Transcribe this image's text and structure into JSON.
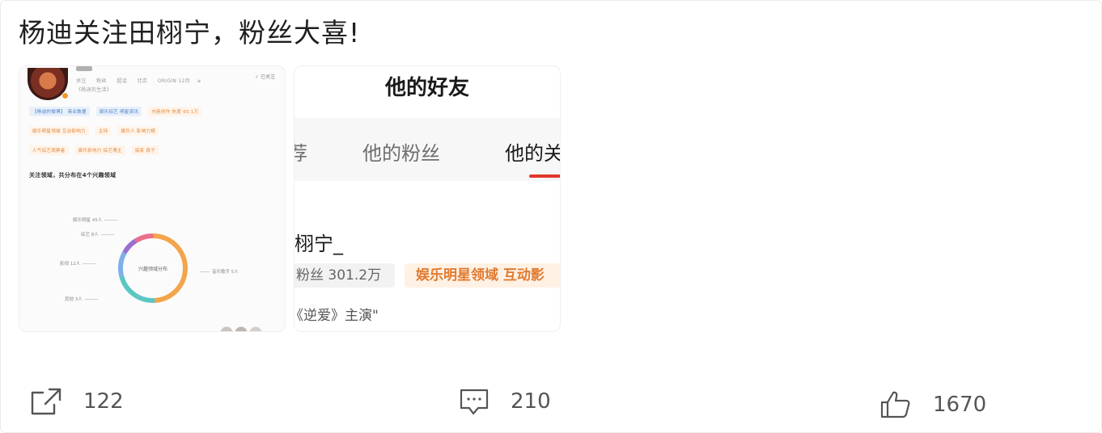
{
  "post": {
    "text": "杨迪关注田栩宁，粉丝大喜!"
  },
  "images": {
    "left": {
      "meta_line1": "关注　　粉丝　　超话　　北京　　ORIGIN 12月　 ≥",
      "meta_line2": "《杨迪的生活》",
      "follow": "✓ 已关注",
      "tags_row1": [
        "【杨迪的微博】　商业数据",
        "娱乐综艺 明星资讯",
        "内容创作 热度 60.1万"
      ],
      "tags_row2": [
        "娱乐明星领域 互动影响力",
        "主持",
        "娱乐人 影响力榜"
      ],
      "tags_row3": [
        "人气综艺观察者",
        "娱乐影响力 综艺博主",
        "搞笑 段子"
      ],
      "section_title": "关注领域，共分布在4个兴趣领域",
      "donut_center": "兴趣领域分布",
      "labels": {
        "left1": "娱乐明星 45人",
        "left2": "综艺 8人",
        "left3": "影视 12人",
        "left4": "其他 3人",
        "right1": "音乐歌手 5人"
      }
    },
    "right": {
      "header_title": "他的好友",
      "tabs": [
        "荐",
        "他的粉丝",
        "他的关"
      ],
      "friend_name": "栩宁_",
      "fans": "粉丝 301.2万",
      "tag": "娱乐明星领域 互动影",
      "desc": "《逆爱》主演\""
    }
  },
  "actions": {
    "share_count": "122",
    "comment_count": "210",
    "like_count": "1670"
  },
  "colors": {
    "accent_red": "#e2362a",
    "tag_orange": "#e07a2f",
    "icon_gray": "#555555"
  },
  "donut_segments": [
    {
      "name": "orange",
      "color": "#f4a44a",
      "fraction": 0.5
    },
    {
      "name": "teal",
      "color": "#5cc7c2",
      "fraction": 0.22
    },
    {
      "name": "blue",
      "color": "#7fb0e8",
      "fraction": 0.12
    },
    {
      "name": "purple",
      "color": "#9b6fd0",
      "fraction": 0.08
    },
    {
      "name": "pink",
      "color": "#ea6f8a",
      "fraction": 0.08
    }
  ]
}
